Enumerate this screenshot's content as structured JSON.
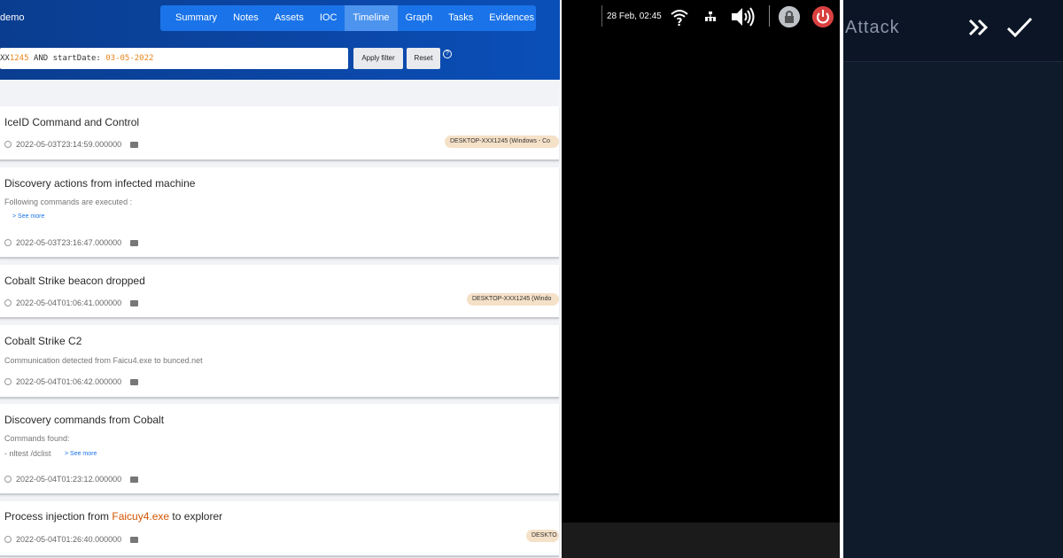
{
  "left": {
    "brand": "demo",
    "nav": [
      "Summary",
      "Notes",
      "Assets",
      "IOC",
      "Timeline",
      "Graph",
      "Tasks",
      "Evidences"
    ],
    "active_tab": "Timeline",
    "search": {
      "prefix": "XX",
      "num1": "1245",
      "middle": " AND startDate: ",
      "num2": "03-05-2022"
    },
    "apply_label": "Apply filter",
    "reset_label": "Reset",
    "help_glyph": "?",
    "events": [
      {
        "title": "IceID Command and Control",
        "desc": "",
        "desc2": "",
        "see_more": "",
        "timestamp": "2022-05-03T23:14:59.000000",
        "asset": "DESKTOP-XXX1245 (Windows - Co"
      },
      {
        "title": "Discovery actions from infected machine",
        "desc": "Following commands are executed :",
        "desc2": "",
        "see_more": "> See more",
        "timestamp": "2022-05-03T23:16:47.000000",
        "asset": ""
      },
      {
        "title": "Cobalt Strike beacon dropped",
        "desc": "",
        "desc2": "",
        "see_more": "",
        "timestamp": "2022-05-04T01:06:41.000000",
        "asset": "DESKTOP-XXX1245 (Windo"
      },
      {
        "title": "Cobalt Strike C2",
        "desc": "Communication detected from Faicu4.exe to bunced.net",
        "desc2": "",
        "see_more": "",
        "timestamp": "2022-05-04T01:06:42.000000",
        "asset": ""
      },
      {
        "title": "Discovery commands from Cobalt",
        "desc": "Commands found:",
        "desc2": "- nltest /dclist",
        "see_more": "> See more",
        "timestamp": "2022-05-04T01:23:12.000000",
        "asset": ""
      },
      {
        "title_pre": "Process injection from ",
        "title_hl": "Faicuy4.exe",
        "title_post": " to explorer",
        "timestamp": "2022-05-04T01:26:40.000000",
        "asset": "DESKTO"
      }
    ]
  },
  "middle": {
    "time": "28 Feb, 02:45"
  },
  "right": {
    "label": "Attack"
  },
  "colors": {
    "header_blue": "#0b47a8",
    "nav_blue": "#1a73e8",
    "highlight_orange": "#d35400",
    "asset_tag": "#f5e1c8",
    "right_bg": "#0f1a2b"
  }
}
